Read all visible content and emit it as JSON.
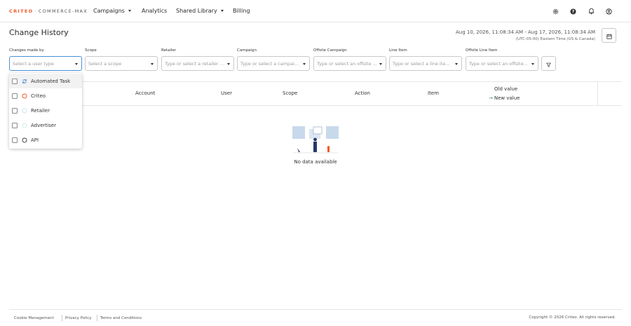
{
  "nav": {
    "logo_brand": "CRITEO",
    "logo_sep": "·",
    "logo_product": "COMMERCE-MAX",
    "items": [
      {
        "label": "Campaigns",
        "has_caret": true
      },
      {
        "label": "Analytics",
        "has_caret": false
      },
      {
        "label": "Shared Library",
        "has_caret": true
      },
      {
        "label": "Billing",
        "has_caret": false
      }
    ],
    "icons": [
      "settings-icon",
      "help-icon",
      "bell-icon",
      "account-icon"
    ]
  },
  "page": {
    "title": "Change History",
    "date_range": "Aug 10, 2026, 11:08:34 AM - Aug 17, 2026, 11:08:34 AM",
    "timezone": "(UTC-05:00) Eastern Time (US & Canada)"
  },
  "filters": [
    {
      "label": "Changes made by",
      "placeholder": "Select a user type"
    },
    {
      "label": "Scope",
      "placeholder": "Select a scope"
    },
    {
      "label": "Retailer",
      "placeholder": "Type or select a retailer f..."
    },
    {
      "label": "Campaign",
      "placeholder": "Type or select a campai..."
    },
    {
      "label": "Offsite Campaign",
      "placeholder": "Type or select an offsite ..."
    },
    {
      "label": "Line Item",
      "placeholder": "Type or select a line item..."
    },
    {
      "label": "Offsite Line Item",
      "placeholder": "Type or select an offsite li..."
    }
  ],
  "dropdown": {
    "options": [
      {
        "label": "Automated Task",
        "icon": "sync-icon",
        "color": "#4a7fd4"
      },
      {
        "label": "Criteo",
        "icon": "circle-icon",
        "color": "#f25a29"
      },
      {
        "label": "Retailer",
        "icon": "circle-icon",
        "color": "#cfe3ee"
      },
      {
        "label": "Advertiser",
        "icon": "circle-icon",
        "color": "#cfeee6"
      },
      {
        "label": "API",
        "icon": "circle-icon",
        "color": "#444444"
      }
    ]
  },
  "table": {
    "columns": [
      "Account",
      "User",
      "Scope",
      "Action",
      "Item"
    ],
    "old_value": "Old value",
    "new_value": "New value",
    "empty_text": "No data available"
  },
  "footer": {
    "links": [
      "Cookie Management",
      "Privacy Policy",
      "Terms and Conditions"
    ],
    "copyright": "Copyright © 2026 Criteo. All rights reserved."
  },
  "colors": {
    "brand": "#f25a29",
    "focus": "#4a90d9",
    "accent_green": "#2e9e6a"
  }
}
